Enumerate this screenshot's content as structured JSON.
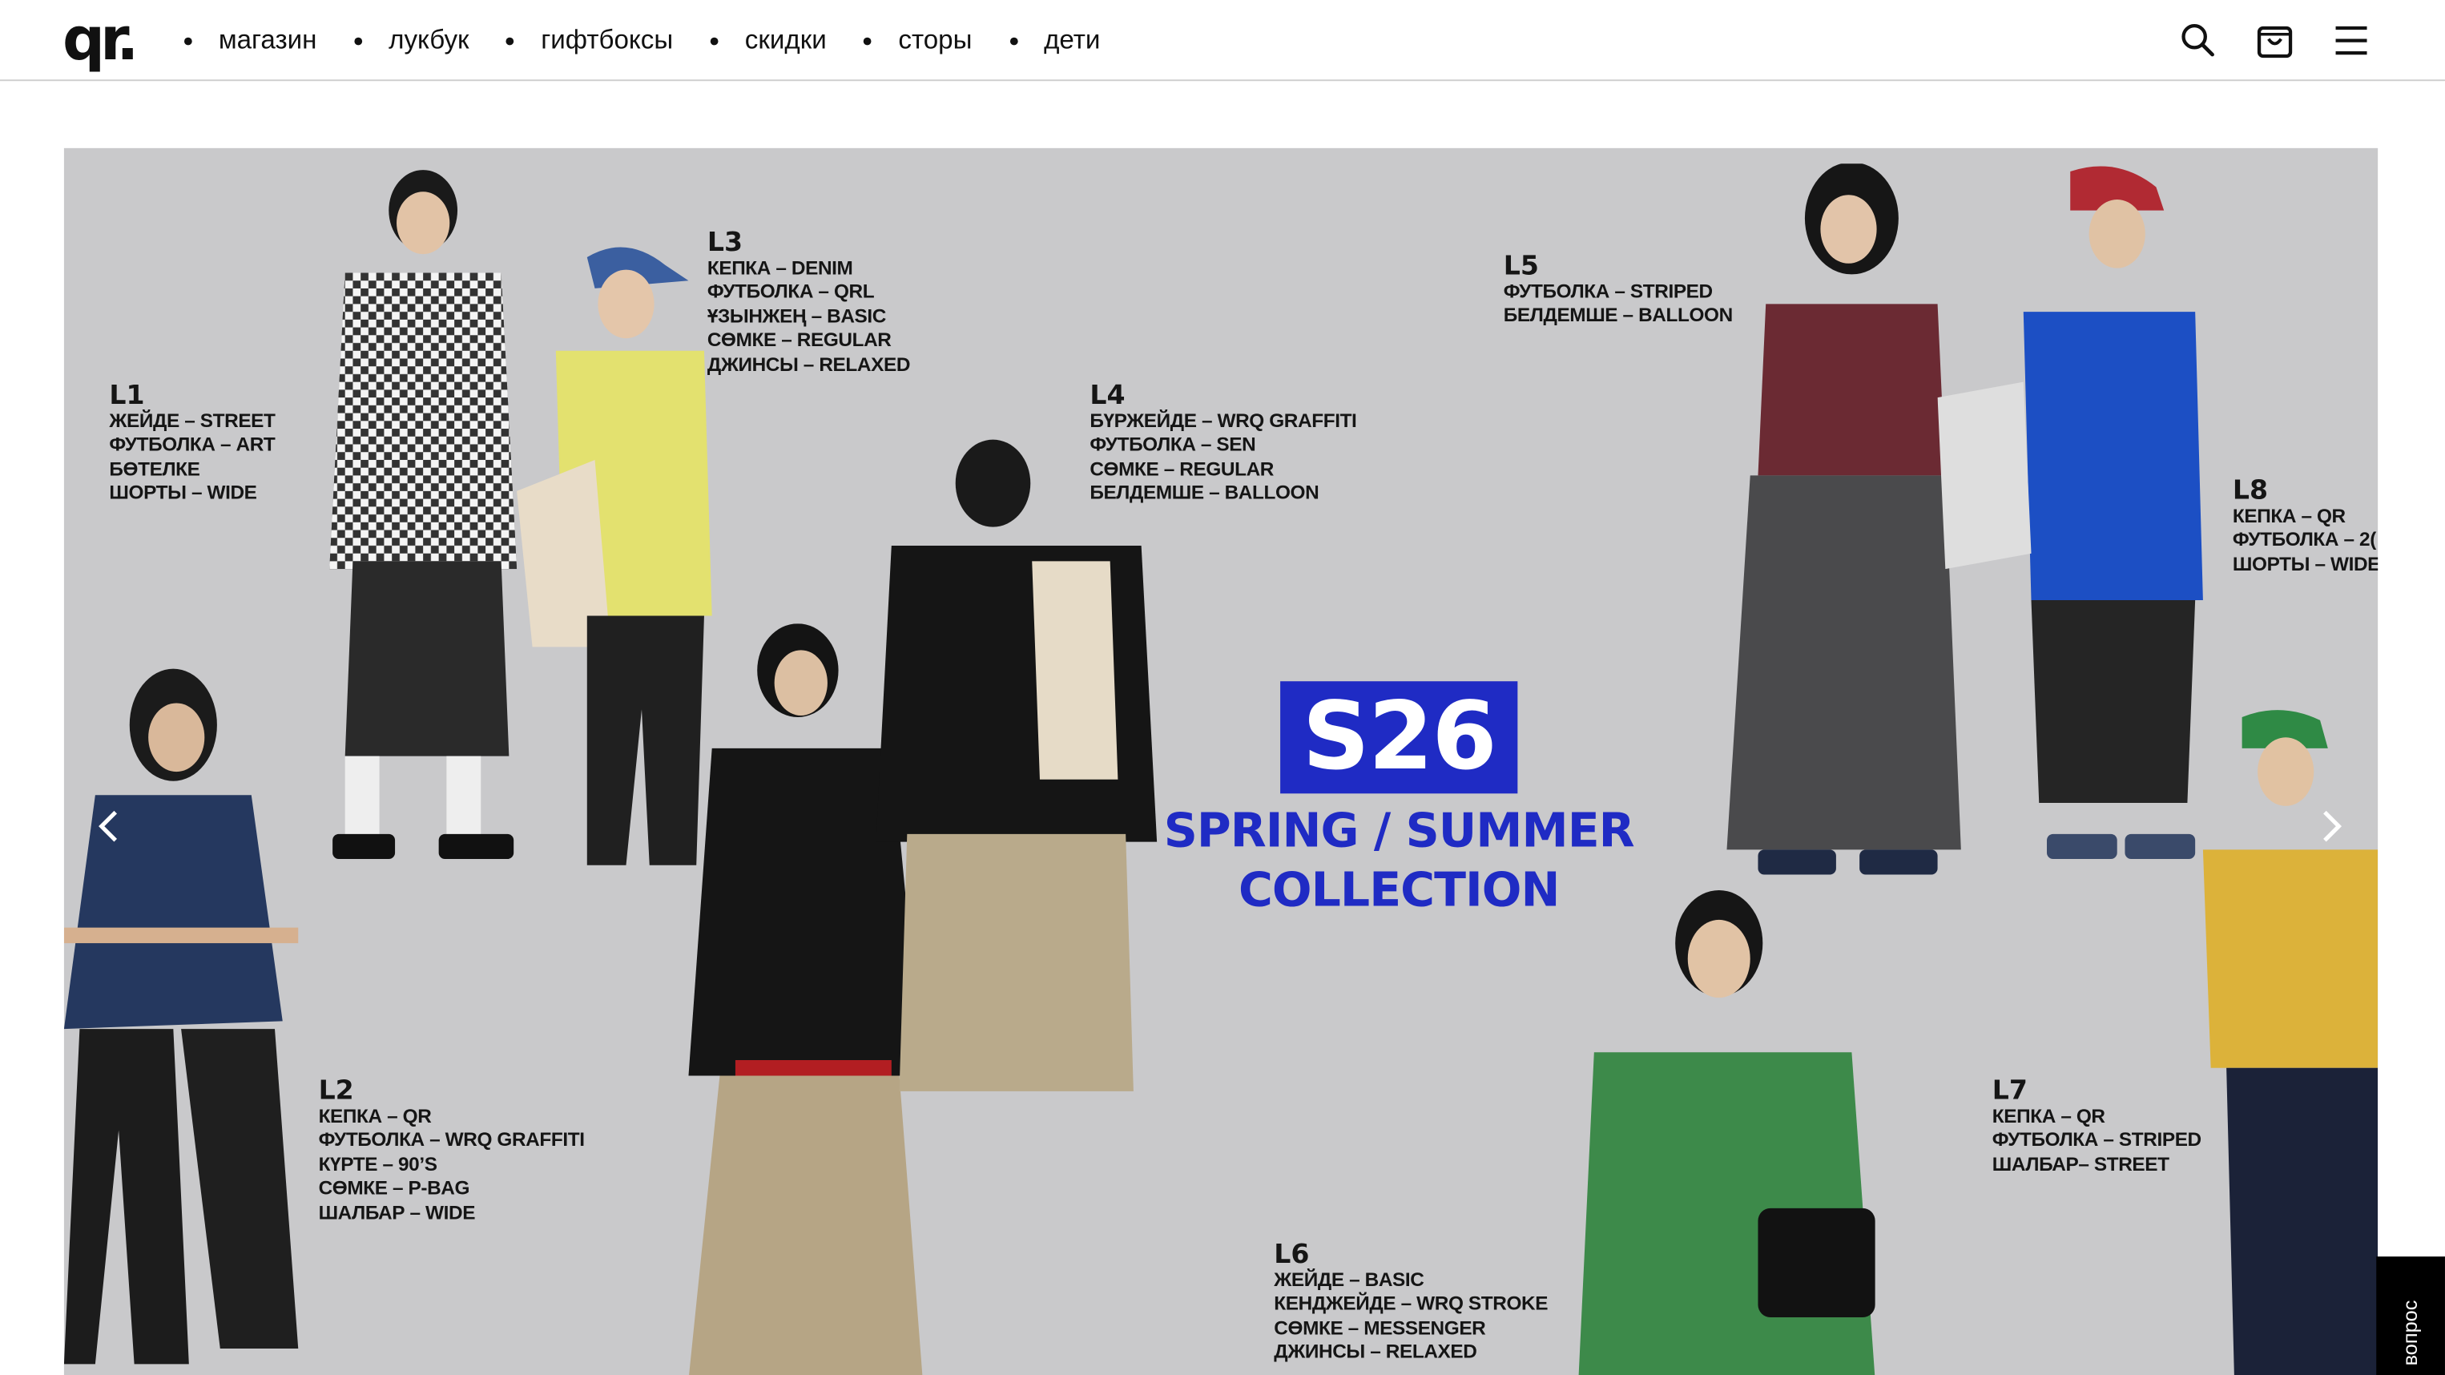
{
  "header": {
    "logo": "qr.",
    "nav": [
      "магазин",
      "лукбук",
      "гифтбоксы",
      "скидки",
      "сторы",
      "дети"
    ]
  },
  "hero": {
    "badge": "S26",
    "collection_line1": "SPRING / SUMMER",
    "collection_line2": "COLLECTION",
    "looks": [
      {
        "code": "L1",
        "items": [
          "ЖЕЙДЕ – STREET",
          "ФУТБОЛКА – ART",
          "БӨТЕЛКЕ",
          "ШОРТЫ – WIDE"
        ]
      },
      {
        "code": "L2",
        "items": [
          "КЕПКА – QR",
          "ФУТБОЛКА – WRQ GRAFFITI",
          "КҮРТЕ – 90’S",
          "СӨМКЕ – P-BAG",
          "ШАЛБАР – WIDE"
        ]
      },
      {
        "code": "L3",
        "items": [
          "КЕПКА – DENIM",
          "ФУТБОЛКА – QRL",
          "ҰЗЫНЖЕҢ – BASIC",
          "СӨМКЕ – REGULAR",
          "ДЖИНСЫ – RELAXED"
        ]
      },
      {
        "code": "L4",
        "items": [
          "БҮРЖЕЙДЕ – WRQ GRAFFITI",
          "ФУТБОЛКА – SEN",
          "СӨМКЕ – REGULAR",
          "БЕЛДЕМШЕ – BALLOON"
        ]
      },
      {
        "code": "L5",
        "items": [
          "ФУТБОЛКА – STRIPED",
          "БЕЛДЕМШЕ – BALLOON"
        ]
      },
      {
        "code": "L6",
        "items": [
          "ЖЕЙДЕ – BASIC",
          "КЕНДЖЕЙДЕ – WRQ STROKE",
          "СӨМКЕ – MESSENGER",
          "ДЖИНСЫ – RELAXED"
        ]
      },
      {
        "code": "L7",
        "items": [
          "КЕПКА – QR",
          "ФУТБОЛКА – STRIPED",
          "ШАЛБАР– STREET"
        ]
      },
      {
        "code": "L8",
        "items": [
          "КЕПКА – QR",
          "ФУТБОЛКА – 2(",
          "ШОРТЫ – WIDE"
        ]
      }
    ]
  },
  "question_tab": "вопрос",
  "colors": {
    "accent": "#1f2bc4",
    "hero_bg": "#c9c9cb",
    "text": "#111111"
  },
  "icons": [
    "search-icon",
    "shopping-bag-icon",
    "menu-icon",
    "chevron-left-icon",
    "chevron-right-icon"
  ]
}
